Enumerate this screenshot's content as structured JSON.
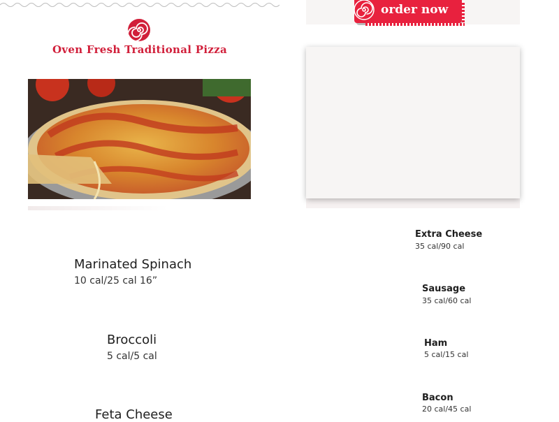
{
  "brand": {
    "title": "Oven Fresh Traditional Pizza",
    "accent_color": "#d11f3a",
    "logo_icon": "red-swirl-icon"
  },
  "order": {
    "label": "order now",
    "color": "#e8213e",
    "icon": "red-swirl-icon"
  },
  "left_toppings": [
    {
      "name": "Marinated Spinach",
      "calories": "10 cal/25 cal 16”"
    },
    {
      "name": "Broccoli",
      "calories": "5 cal/5 cal"
    },
    {
      "name": "Feta Cheese",
      "calories": ""
    }
  ],
  "right_toppings": [
    {
      "name": "Extra Cheese",
      "calories": "35 cal/90 cal"
    },
    {
      "name": "Sausage",
      "calories": "35 cal/60 cal"
    },
    {
      "name": "Ham",
      "calories": "5 cal/15 cal"
    },
    {
      "name": "Bacon",
      "calories": "20 cal/45 cal"
    }
  ]
}
